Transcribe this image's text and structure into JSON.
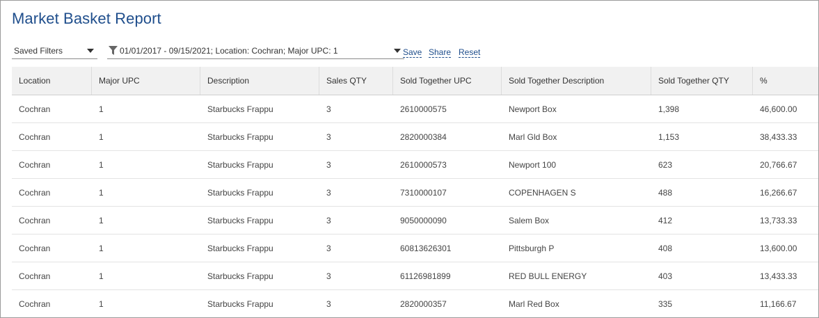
{
  "page": {
    "title": "Market Basket Report"
  },
  "toolbar": {
    "saved_filters_label": "Saved Filters",
    "filter_summary": "01/01/2017 - 09/15/2021; Location: Cochran; Major UPC: 1",
    "save_label": "Save",
    "share_label": "Share",
    "reset_label": "Reset"
  },
  "table": {
    "columns": [
      "Location",
      "Major UPC",
      "Description",
      "Sales QTY",
      "Sold Together UPC",
      "Sold Together Description",
      "Sold Together QTY",
      "%"
    ],
    "rows": [
      [
        "Cochran",
        "1",
        "Starbucks Frappu",
        "3",
        "2610000575",
        "Newport Box",
        "1,398",
        "46,600.00"
      ],
      [
        "Cochran",
        "1",
        "Starbucks Frappu",
        "3",
        "2820000384",
        "Marl Gld Box",
        "1,153",
        "38,433.33"
      ],
      [
        "Cochran",
        "1",
        "Starbucks Frappu",
        "3",
        "2610000573",
        "Newport 100",
        "623",
        "20,766.67"
      ],
      [
        "Cochran",
        "1",
        "Starbucks Frappu",
        "3",
        "7310000107",
        "COPENHAGEN S",
        "488",
        "16,266.67"
      ],
      [
        "Cochran",
        "1",
        "Starbucks Frappu",
        "3",
        "9050000090",
        "Salem Box",
        "412",
        "13,733.33"
      ],
      [
        "Cochran",
        "1",
        "Starbucks Frappu",
        "3",
        "60813626301",
        "Pittsburgh P",
        "408",
        "13,600.00"
      ],
      [
        "Cochran",
        "1",
        "Starbucks Frappu",
        "3",
        "61126981899",
        "RED BULL ENERGY",
        "403",
        "13,433.33"
      ],
      [
        "Cochran",
        "1",
        "Starbucks Frappu",
        "3",
        "2820000357",
        "Marl Red Box",
        "335",
        "11,166.67"
      ]
    ]
  },
  "icons": {
    "filter": "filter-funnel-icon",
    "dropdown": "chevron-down-icon"
  },
  "colors": {
    "title": "#1f4e8c",
    "link": "#1f4e8c",
    "header_bg": "#f1f1f1"
  }
}
